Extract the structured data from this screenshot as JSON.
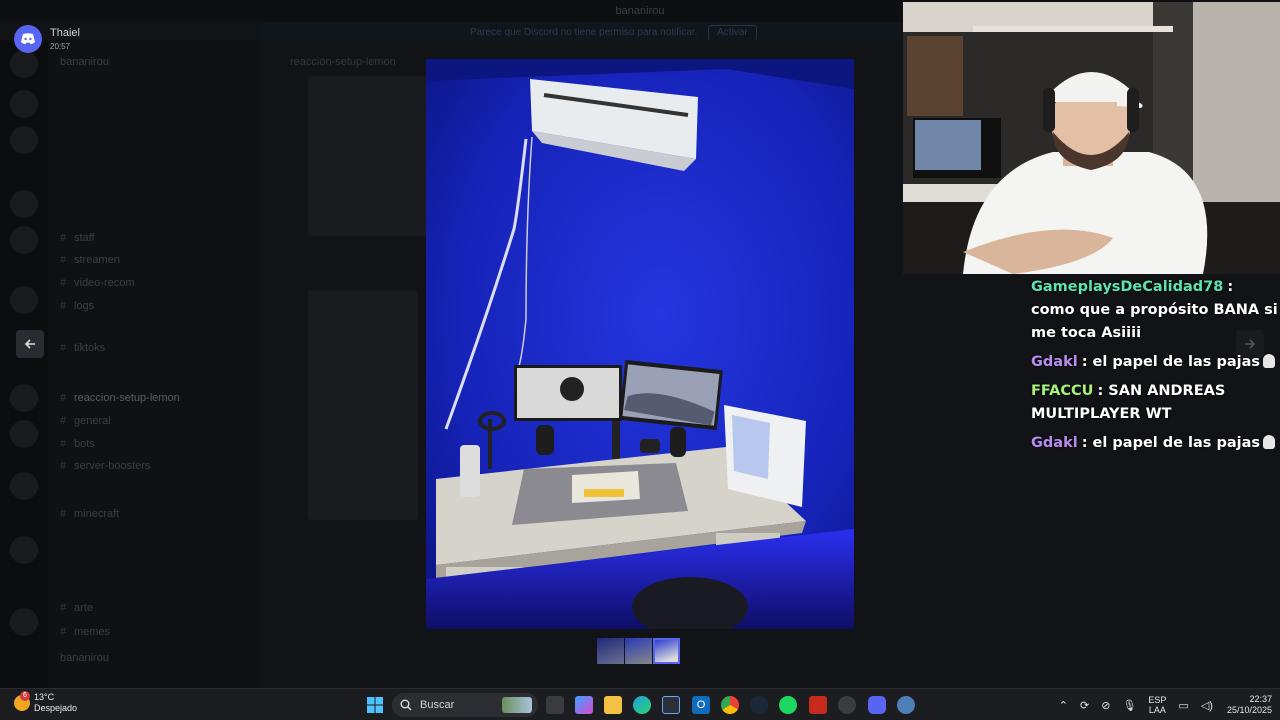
{
  "notification": {
    "name": "Thaiel",
    "time": "20:57"
  },
  "top_title": "bananirou",
  "notice": {
    "text": "Parece que Discord no tiene permiso para notificar.",
    "button": "Activar"
  },
  "discord": {
    "channel_rows": [
      "bananirou",
      "",
      "",
      "",
      "",
      "",
      "",
      "staff",
      "streamen",
      "video-recom",
      "logs",
      "",
      "tiktoks",
      "",
      "reaccion-setup-lemon",
      "general",
      "bots",
      "server-boosters",
      "",
      "minecraft",
      "",
      "",
      "",
      "arte",
      "memes"
    ],
    "chat_header": "reaccion-setup-lemon",
    "user_name": "bananirou"
  },
  "stream_chat": [
    {
      "user": "GameplaysDeCalidad78",
      "color": "#5ee3b0",
      "text": "como que a propósito BANA si me toca Asiiii",
      "skull": false
    },
    {
      "user": "Gdakl",
      "color": "#b98cf0",
      "text": "el papel de las pajas",
      "skull": true
    },
    {
      "user": "FFACCU",
      "color": "#a7f27a",
      "text": "SAN ANDREAS MULTIPLAYER WT",
      "skull": false
    },
    {
      "user": "Gdakl",
      "color": "#b98cf0",
      "text": "el papel de las pajas",
      "skull": true
    }
  ],
  "taskbar": {
    "weather_temp": "13°C",
    "weather_desc": "Despejado",
    "weather_badge": "6",
    "search_placeholder": "Buscar",
    "lang_top": "ESP",
    "lang_bottom": "LAA",
    "time": "22:37",
    "date": "25/10/2025"
  },
  "colors": {
    "discord_blurple": "#5865f2",
    "wall_blue": "#1a27c9"
  }
}
